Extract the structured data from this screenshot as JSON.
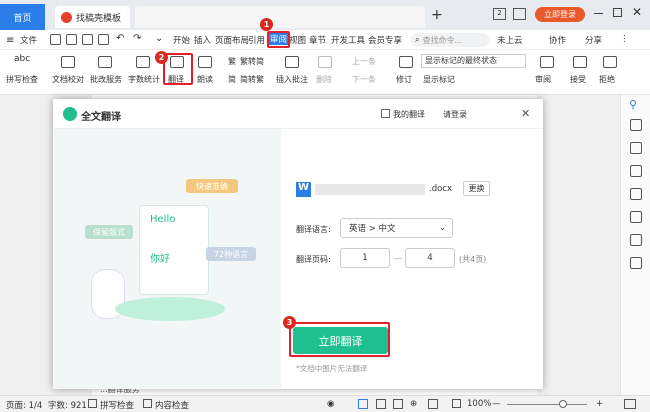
{
  "tabs": {
    "home": "首页",
    "template": "找稿壳模板",
    "new_tab": "+"
  },
  "window": {
    "badge": "2",
    "login": "立即登录"
  },
  "menubar": {
    "file": "文件",
    "items": [
      "开始",
      "插入",
      "页面布局",
      "引用",
      "审阅",
      "视图",
      "章节",
      "开发工具",
      "会员专享"
    ],
    "search_placeholder": "查找命令...",
    "cloud": "未上云",
    "collab": "协作",
    "share": "分享"
  },
  "ribbon": {
    "spellcheck": "拼写检查",
    "doc_proof": "文档校对",
    "batch": "批改服务",
    "word_count": "字数统计",
    "translate": "翻译",
    "read_aloud": "朗读",
    "trad_to_simp": "繁转简",
    "simp_to_trad": "简转繁",
    "insert_comment": "插入批注",
    "delete": "删除",
    "prev": "上一条",
    "next": "下一条",
    "revise": "修订",
    "show_state": "显示标记的最终状态",
    "show_marks": "显示标记",
    "review": "审阅",
    "accept": "接受",
    "reject": "拒绝"
  },
  "badges": {
    "one": "1",
    "two": "2",
    "three": "3"
  },
  "dialog": {
    "title": "全文翻译",
    "my_translations": "我的翻译",
    "login": "请登录",
    "close": "✕",
    "file_ext": ".docx",
    "change": "更换",
    "lang_label": "翻译语言:",
    "lang_value": "英语 > 中文",
    "pages_label": "翻译页码:",
    "page_from": "1",
    "page_sep": "—",
    "page_to": "4",
    "page_total": "(共4页)",
    "button": "立即翻译",
    "note": "*文档中图片无法翻译",
    "bubbles": {
      "fast": "快速准确",
      "format": "保留版式",
      "hello": "Hello",
      "nihao": "你好",
      "lang72": "72种语言"
    }
  },
  "doc": {
    "bottom_text": "...翻译服务"
  },
  "statusbar": {
    "page": "页面: 1/4",
    "words": "字数: 921",
    "spell": "拼写检查",
    "content": "内容检查",
    "zoom": "100%"
  },
  "colors": {
    "accent": "#2b7de9",
    "green": "#1fbf8f",
    "red": "#e0202a"
  }
}
